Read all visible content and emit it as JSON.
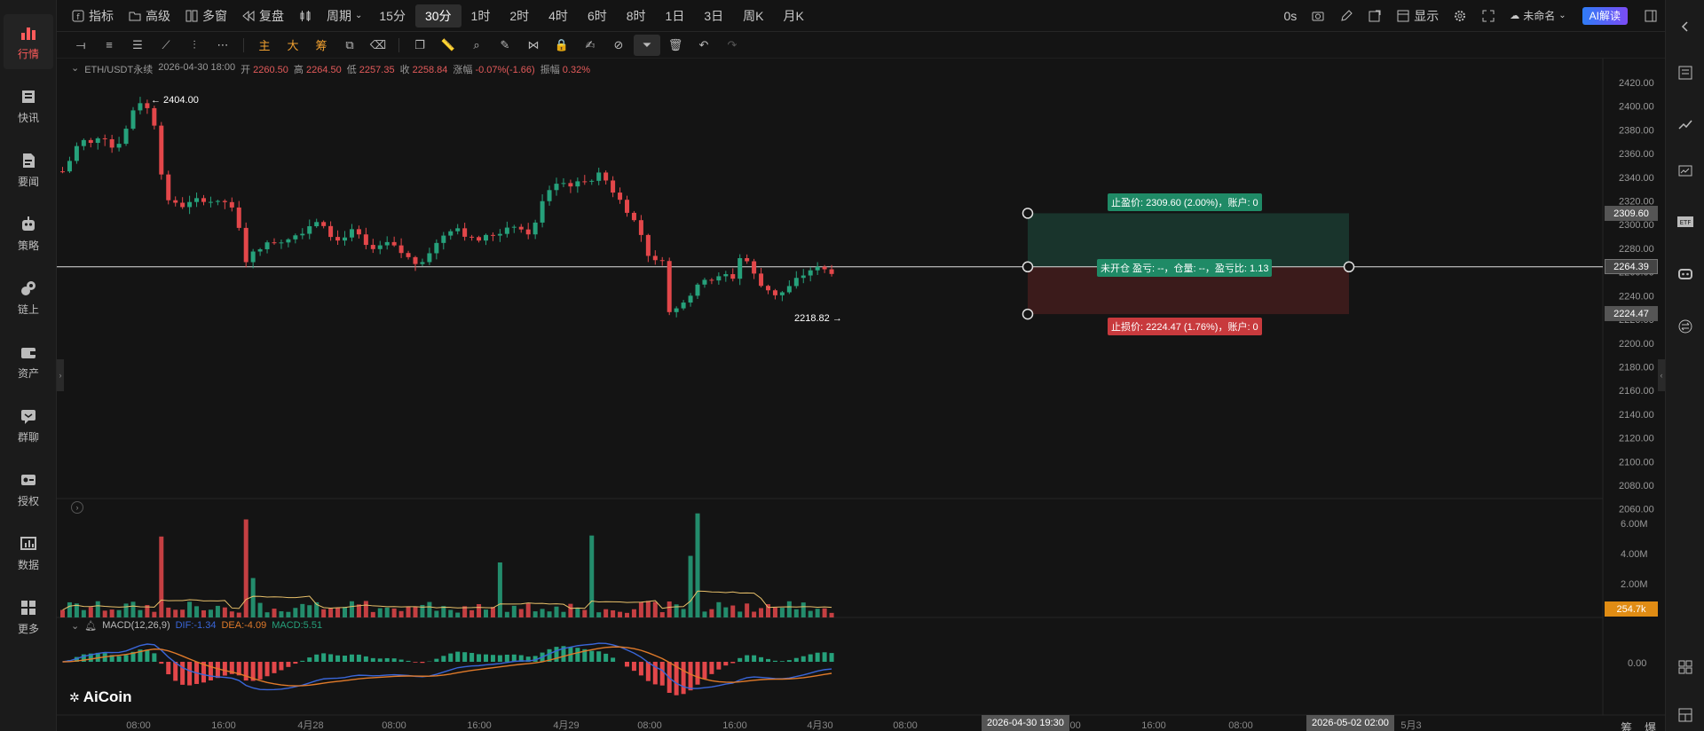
{
  "left_sidebar": {
    "items": [
      {
        "label": "行情",
        "icon": "bar-chart-icon",
        "active": true
      },
      {
        "label": "快讯",
        "icon": "news-flash-icon"
      },
      {
        "label": "要闻",
        "icon": "document-icon"
      },
      {
        "label": "策略",
        "icon": "robot-icon"
      },
      {
        "label": "链上",
        "icon": "chain-icon"
      },
      {
        "label": "资产",
        "icon": "wallet-icon"
      },
      {
        "label": "群聊",
        "icon": "chat-icon"
      },
      {
        "label": "授权",
        "icon": "key-icon"
      },
      {
        "label": "数据",
        "icon": "data-icon"
      },
      {
        "label": "更多",
        "icon": "grid-icon"
      }
    ]
  },
  "topbar": {
    "indicator": "指标",
    "advanced": "高级",
    "multi_window": "多窗",
    "replay": "复盘",
    "period": "周期",
    "intervals": [
      "15分",
      "30分",
      "1时",
      "2时",
      "4时",
      "6时",
      "8时",
      "1日",
      "3日",
      "周K",
      "月K"
    ],
    "active_interval": "30分",
    "countdown": "0s",
    "display": "显示",
    "unnamed": "未命名",
    "ai_button": "AI解读"
  },
  "drawbar": {
    "main_label": "主",
    "big_label": "大",
    "chip_label": "筹"
  },
  "info": {
    "symbol": "ETH/USDT永续",
    "datetime": "2026-04-30 18:00",
    "open_label": "开",
    "open": "2260.50",
    "high_label": "高",
    "high": "2264.50",
    "low_label": "低",
    "low": "2257.35",
    "close_label": "收",
    "close": "2258.84",
    "change_label": "涨幅",
    "change": "-0.07%(-1.66)",
    "amp_label": "振幅",
    "amp": "0.32%"
  },
  "annotations": {
    "high_marker": "← 2404.00",
    "low_marker": "2218.82 →",
    "take_profit": "止盈价: 2309.60 (2.00%)，账户: 0",
    "stop_loss": "止损价: 2224.47 (1.76%)，账户: 0",
    "position": "未开仓 盈亏: --，仓量: --，盈亏比: 1.13",
    "current_price": "2264.39",
    "tp_price": "2309.60",
    "sl_price": "2224.47",
    "volume_tag": "254.7k"
  },
  "price_axis": [
    "2420.00",
    "2400.00",
    "2380.00",
    "2360.00",
    "2340.00",
    "2320.00",
    "2300.00",
    "2280.00",
    "2260.00",
    "2240.00",
    "2220.00",
    "2200.00",
    "2180.00",
    "2160.00",
    "2140.00",
    "2120.00",
    "2100.00",
    "2080.00",
    "2060.00"
  ],
  "volume_axis": [
    "6.00M",
    "4.00M",
    "2.00M"
  ],
  "macd_axis": [
    "0.00"
  ],
  "macd": {
    "label": "MACD(12,26,9)",
    "dif": "DIF:-1.34",
    "dea": "DEA:-4.09",
    "macd": "MACD:5.51"
  },
  "logo": "AiCoin",
  "time_axis": [
    "08:00",
    "16:00",
    "4月28",
    "08:00",
    "16:00",
    "4月29",
    "08:00",
    "16:00",
    "4月30",
    "08:00",
    "1",
    "08:00",
    "16:00",
    "08:00",
    "16:00",
    "5月3"
  ],
  "time_tag_current": "2026-04-30 19:30",
  "time_tag_end": "2026-05-02 02:00",
  "bottom_right": [
    "筹",
    "爆"
  ],
  "colors": {
    "up": "#26a17b",
    "down": "#e3474a",
    "bg": "#141414",
    "accent": "#ff5b5b"
  },
  "chart_data": {
    "type": "candlestick",
    "ylim": [
      2060,
      2430
    ],
    "candles": []
  }
}
